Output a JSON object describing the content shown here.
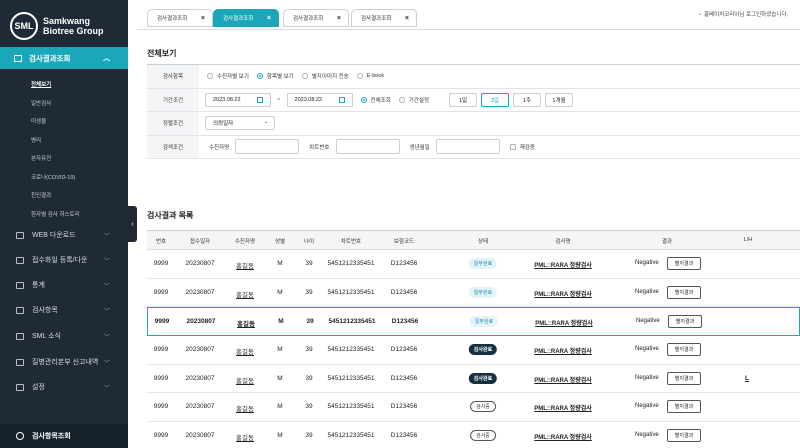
{
  "logo": {
    "mark": "SML",
    "line1": "Samkwang",
    "line2": "Biotree Group"
  },
  "sidebar": {
    "active_menu": "검사결과조회",
    "submenu": [
      "전체보기",
      "일반검사",
      "미생물",
      "병리",
      "분자유전",
      "코로나(COVID-19)",
      "친인결과",
      "환자별 검사 히스토리"
    ],
    "menu_items": [
      {
        "label": "WEB 다운로드"
      },
      {
        "label": "접수화일 등록/다운"
      },
      {
        "label": "통계"
      },
      {
        "label": "검사항목"
      },
      {
        "label": "SML 소식"
      },
      {
        "label": "질병관리본부 신고내역"
      },
      {
        "label": "설정"
      }
    ],
    "bottom": "검사항목조회"
  },
  "tabs": [
    {
      "label": "검사결과조회",
      "active": false
    },
    {
      "label": "검사결과조회",
      "active": true
    },
    {
      "label": "검사결과조회",
      "active": false
    },
    {
      "label": "검사결과조회",
      "active": false
    }
  ],
  "user_info": "홍베이치코리아님 로그인하셨습니다.",
  "page_title": "전체보기",
  "filters": {
    "view_label": "검사항목",
    "view_options": [
      "수진자별 보기",
      "항목별 보기",
      "별지이미지 전송",
      "E-book"
    ],
    "view_selected": 1,
    "period_label": "기간조건",
    "date_from": "2023.08.22",
    "date_to": "2023.08.22",
    "period_options": [
      "전체조회",
      "기간설정"
    ],
    "period_selected": 0,
    "period_buttons": [
      "1일",
      "3일",
      "1주",
      "1개월"
    ],
    "period_button_selected": 1,
    "sort_label": "정렬조건",
    "sort_value": "의뢰일자",
    "search_label": "검색조건",
    "search_fields": [
      "수진자명",
      "차트번호",
      "생년월일"
    ],
    "recheck_label": "재검증"
  },
  "results": {
    "title": "검사결과 목록",
    "columns": [
      "번호",
      "접수일자",
      "수진자명",
      "성별",
      "나이",
      "차트번호",
      "보험코드",
      "상태",
      "검사명",
      "결과",
      "L/H"
    ],
    "detail_label": "별지결과",
    "rows": [
      {
        "no": "9999",
        "date": "20230807",
        "name": "홍길동",
        "sex": "M",
        "age": "39",
        "chart": "5451212335451",
        "code": "D123456",
        "status": "일부완료",
        "status_type": "partial",
        "test": "PML::RARA 정량검사",
        "result": "Negative",
        "lh": ""
      },
      {
        "no": "9999",
        "date": "20230807",
        "name": "홍길동",
        "sex": "M",
        "age": "39",
        "chart": "5451212335451",
        "code": "D123456",
        "status": "일부완료",
        "status_type": "partial",
        "test": "PML::RARA 정량검사",
        "result": "Negative",
        "lh": ""
      },
      {
        "no": "9999",
        "date": "20230807",
        "name": "홍길동",
        "sex": "M",
        "age": "39",
        "chart": "5451212335451",
        "code": "D123456",
        "status": "일부완료",
        "status_type": "partial",
        "test": "PML::RARA 정량검사",
        "result": "Negative",
        "lh": "",
        "highlight": true
      },
      {
        "no": "9999",
        "date": "20230807",
        "name": "홍길동",
        "sex": "M",
        "age": "39",
        "chart": "5451212335451",
        "code": "D123456",
        "status": "검사완료",
        "status_type": "done",
        "test": "PML::RARA 정량검사",
        "result": "Negative",
        "lh": ""
      },
      {
        "no": "9999",
        "date": "20230807",
        "name": "홍길동",
        "sex": "M",
        "age": "39",
        "chart": "5451212335451",
        "code": "D123456",
        "status": "검사완료",
        "status_type": "done",
        "test": "PML::RARA 정량검사",
        "result": "Negative",
        "lh": "L"
      },
      {
        "no": "9999",
        "date": "20230807",
        "name": "홍길동",
        "sex": "M",
        "age": "39",
        "chart": "5451212335451",
        "code": "D123456",
        "status": "검사중",
        "status_type": "progress",
        "test": "PML::RARA 정량검사",
        "result": "Negative",
        "lh": ""
      },
      {
        "no": "9999",
        "date": "20230807",
        "name": "홍길동",
        "sex": "M",
        "age": "39",
        "chart": "5451212335451",
        "code": "D123456",
        "status": "검사중",
        "status_type": "progress",
        "test": "PML::RARA 정량검사",
        "result": "Negative",
        "lh": ""
      }
    ]
  },
  "colors": {
    "accent": "#1aa7b8",
    "sidebar": "#1f2a36",
    "badge_done": "#16303f"
  }
}
